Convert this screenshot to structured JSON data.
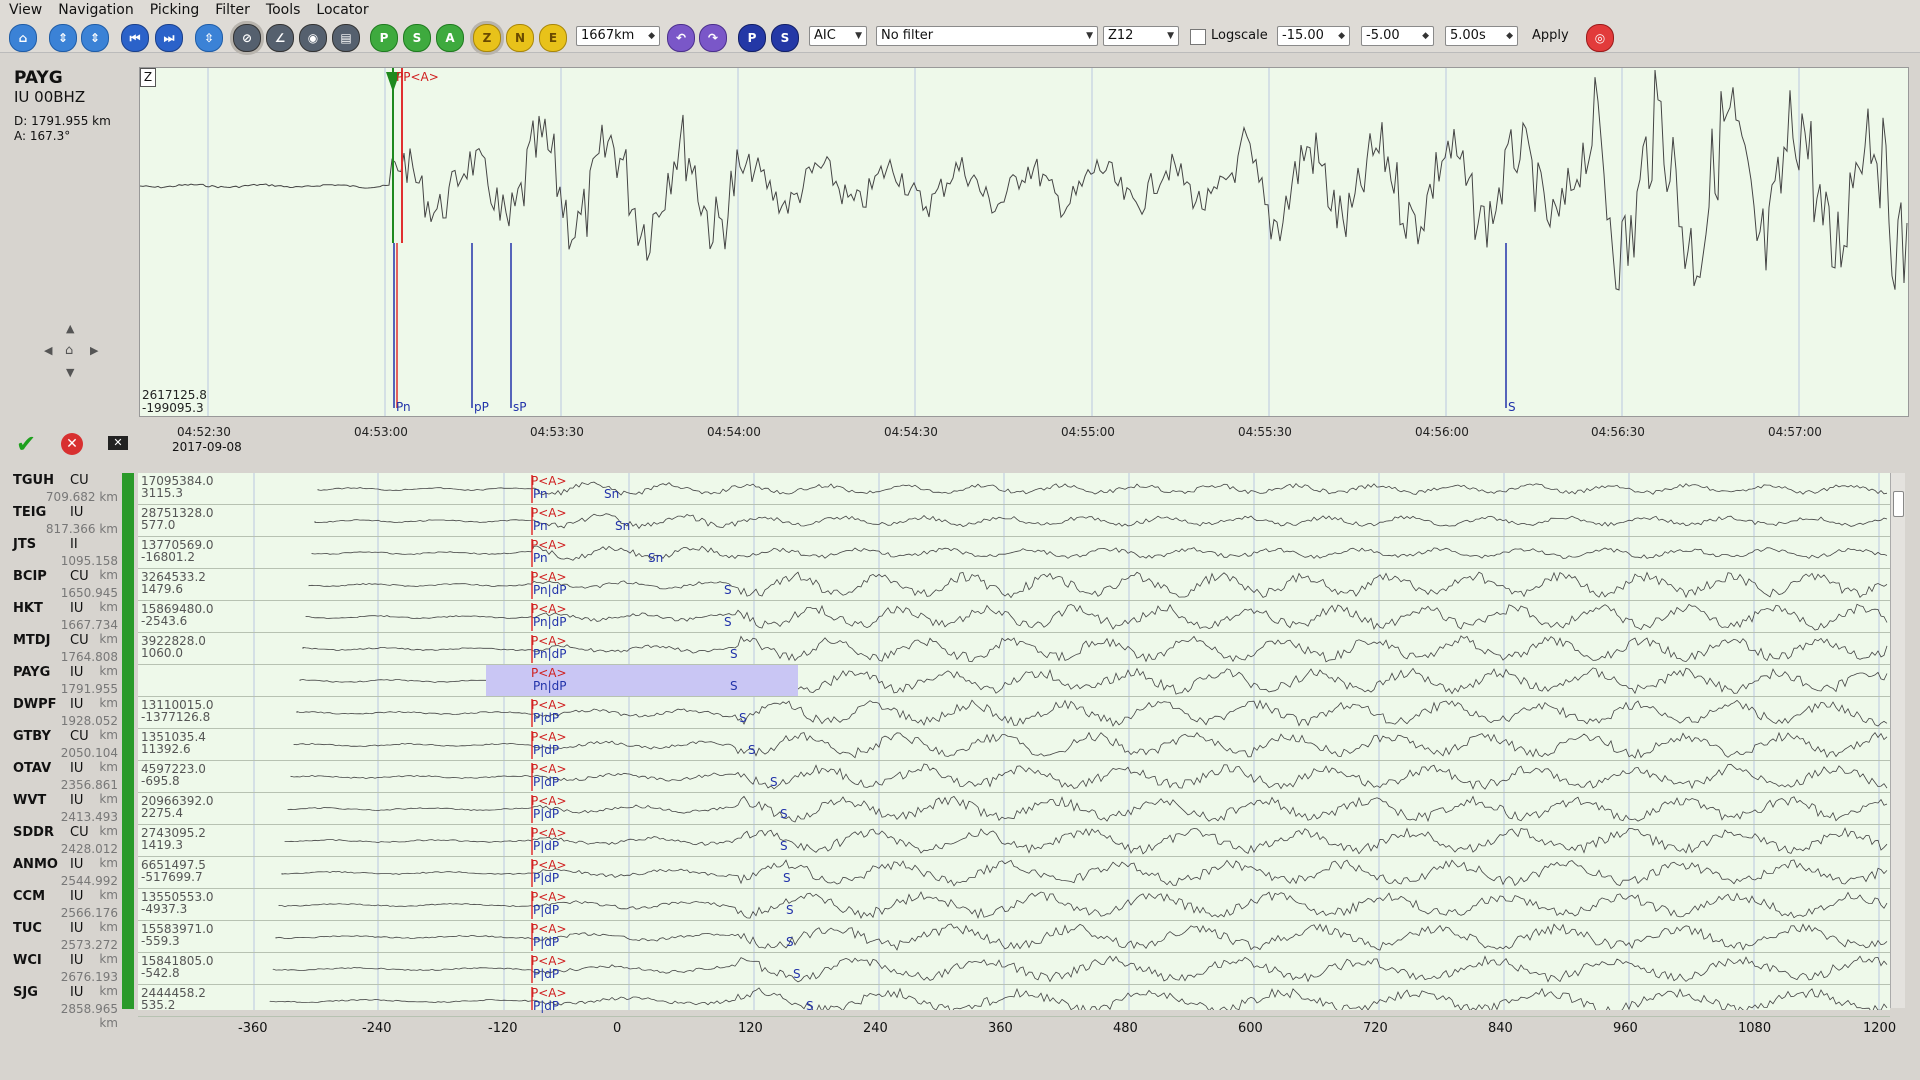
{
  "menu": [
    "View",
    "Navigation",
    "Picking",
    "Filter",
    "Tools",
    "Locator"
  ],
  "toolbar": {
    "distance_value": "1667km",
    "picker_select": "AIC",
    "filter_select": "No filter",
    "component_select": "Z12",
    "logscale_label": "Logscale",
    "min_value": "-15.00",
    "max_value": "-5.00",
    "time_value": "5.00s",
    "apply_label": "Apply",
    "buttons": [
      {
        "name": "home-icon",
        "glyph": "⌂",
        "color": "blue"
      },
      {
        "name": "align-up-icon",
        "glyph": "⇕",
        "color": "blue"
      },
      {
        "name": "align-down-icon",
        "glyph": "⇕",
        "color": "blue"
      },
      {
        "name": "prev-icon",
        "glyph": "⏮",
        "color": "blue2"
      },
      {
        "name": "next-icon",
        "glyph": "⏭",
        "color": "blue2"
      },
      {
        "name": "sort-icon",
        "glyph": "⇳",
        "color": "blue"
      },
      {
        "name": "no-theoretical-icon",
        "glyph": "⊘",
        "color": "dark"
      },
      {
        "name": "ruler-icon",
        "glyph": "∠",
        "color": "dark"
      },
      {
        "name": "zoom-icon",
        "glyph": "◉",
        "color": "dark"
      },
      {
        "name": "print-icon",
        "glyph": "▤",
        "color": "dark"
      },
      {
        "name": "p-pick-icon",
        "glyph": "P",
        "color": "green"
      },
      {
        "name": "s-pick-icon",
        "glyph": "S",
        "color": "green"
      },
      {
        "name": "auto-pick-icon",
        "glyph": "A",
        "color": "green"
      },
      {
        "name": "z-component-icon",
        "glyph": "Z",
        "color": "yellow"
      },
      {
        "name": "n-component-icon",
        "glyph": "N",
        "color": "yellow"
      },
      {
        "name": "e-component-icon",
        "glyph": "E",
        "color": "yellow"
      },
      {
        "name": "undo-icon",
        "glyph": "↶",
        "color": "purple"
      },
      {
        "name": "redo-icon",
        "glyph": "↷",
        "color": "purple"
      },
      {
        "name": "p-phase-icon",
        "glyph": "P",
        "color": "navy"
      },
      {
        "name": "s-phase-icon",
        "glyph": "S",
        "color": "navy"
      },
      {
        "name": "target-icon",
        "glyph": "◎",
        "color": "red"
      }
    ]
  },
  "current_station": {
    "code": "PAYG",
    "channel": "IU  00BHZ",
    "distance": "D: 1791.955 km",
    "azimuth": "A: 167.3°",
    "component": "Z",
    "amp_max": "2617125.8",
    "amp_min": "-199095.3",
    "date": "2017-09-08",
    "time_ticks": [
      "04:52:30",
      "04:53:00",
      "04:53:30",
      "04:54:00",
      "04:54:30",
      "04:55:00",
      "04:55:30",
      "04:56:00",
      "04:56:30",
      "04:57:00"
    ],
    "picks_labels": [
      "Pn",
      "pP",
      "sP",
      "S"
    ],
    "pick_top": "PP<A>"
  },
  "stations": [
    {
      "code": "TGUH",
      "net": "CU",
      "dist": "709.682 km",
      "amax": "17095384.0",
      "amin": "3115.3",
      "picks": [
        "Pn",
        "Sn"
      ]
    },
    {
      "code": "TEIG",
      "net": "IU",
      "dist": "817.366 km",
      "amax": "28751328.0",
      "amin": "577.0",
      "picks": [
        "Pn",
        "Sn"
      ]
    },
    {
      "code": "JTS",
      "net": "II",
      "dist": "1095.158 km",
      "amax": "13770569.0",
      "amin": "-16801.2",
      "picks": [
        "Pn",
        "Sn"
      ]
    },
    {
      "code": "BCIP",
      "net": "CU",
      "dist": "1650.945 km",
      "amax": "3264533.2",
      "amin": "1479.6",
      "picks": [
        "Pn|dP",
        "S"
      ]
    },
    {
      "code": "HKT",
      "net": "IU",
      "dist": "1667.734 km",
      "amax": "15869480.0",
      "amin": "-2543.6",
      "picks": [
        "Pn|dP",
        "S"
      ]
    },
    {
      "code": "MTDJ",
      "net": "CU",
      "dist": "1764.808 km",
      "amax": "3922828.0",
      "amin": "1060.0",
      "picks": [
        "Pn|dP",
        "S"
      ]
    },
    {
      "code": "PAYG",
      "net": "IU",
      "dist": "1791.955 km",
      "amax": "",
      "amin": "",
      "picks": [
        "Pn|dP",
        "S"
      ]
    },
    {
      "code": "DWPF",
      "net": "IU",
      "dist": "1928.052 km",
      "amax": "13110015.0",
      "amin": "-1377126.8",
      "picks": [
        "P|dP",
        "S"
      ]
    },
    {
      "code": "GTBY",
      "net": "CU",
      "dist": "2050.104 km",
      "amax": "1351035.4",
      "amin": "11392.6",
      "picks": [
        "P|dP",
        "S"
      ]
    },
    {
      "code": "OTAV",
      "net": "IU",
      "dist": "2356.861 km",
      "amax": "4597223.0",
      "amin": "-695.8",
      "picks": [
        "P|dP",
        "S"
      ]
    },
    {
      "code": "WVT",
      "net": "IU",
      "dist": "2413.493 km",
      "amax": "20966392.0",
      "amin": "2275.4",
      "picks": [
        "P|dP",
        "S"
      ]
    },
    {
      "code": "SDDR",
      "net": "CU",
      "dist": "2428.012 km",
      "amax": "2743095.2",
      "amin": "1419.3",
      "picks": [
        "P|dP",
        "S"
      ]
    },
    {
      "code": "ANMO",
      "net": "IU",
      "dist": "2544.992 km",
      "amax": "6651497.5",
      "amin": "-517699.7",
      "picks": [
        "P|dP",
        "S"
      ]
    },
    {
      "code": "CCM",
      "net": "IU",
      "dist": "2566.176 km",
      "amax": "13550553.0",
      "amin": "-4937.3",
      "picks": [
        "P|dP",
        "S"
      ]
    },
    {
      "code": "TUC",
      "net": "IU",
      "dist": "2573.272 km",
      "amax": "15583971.0",
      "amin": "-559.3",
      "picks": [
        "P|dP",
        "S"
      ]
    },
    {
      "code": "WCI",
      "net": "IU",
      "dist": "2676.193 km",
      "amax": "15841805.0",
      "amin": "-542.8",
      "picks": [
        "P|dP",
        "S"
      ]
    },
    {
      "code": "SJG",
      "net": "IU",
      "dist": "2858.965 km",
      "amax": "2444458.2",
      "amin": "535.2",
      "picks": [
        "P|dP",
        "S"
      ]
    }
  ],
  "pick_tag": "P<A>",
  "bottom_axis_ticks": [
    "-360",
    "-240",
    "-120",
    "0",
    "120",
    "240",
    "360",
    "480",
    "600",
    "720",
    "840",
    "960",
    "1080",
    "1200"
  ]
}
